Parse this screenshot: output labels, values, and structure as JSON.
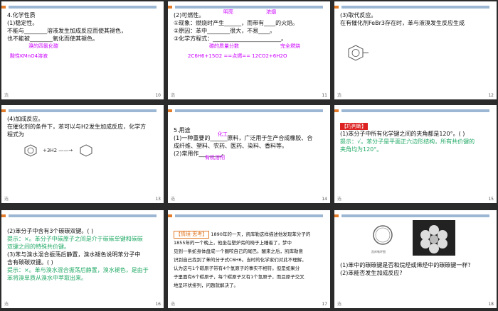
{
  "slides": [
    {
      "num": "10",
      "corner": "选",
      "lines": [
        "4.化学性质",
        "(1)稳定性。",
        "不能与________溶液发生加成反应而使其褪色，",
        "也不能被________氧化而使其褪色。"
      ],
      "answers": [
        "溴的四氯化碳",
        "酸性KMnO4溶液"
      ]
    },
    {
      "num": "11",
      "corner": "选",
      "lines": [
        "(2)可燃性。",
        "①现象：燃烧时产生______，而带有____的火焰。",
        "②原因：苯中________很大，不易____。",
        "③化学方程式：________________________。"
      ],
      "answers": [
        "明亮",
        "浓烟",
        "碳的质量分数",
        "完全燃烧",
        "2C6H6+15O2 ==点燃== 12CO2+6H2O"
      ]
    },
    {
      "num": "12",
      "corner": "选",
      "lines": [
        "(3)取代反应。",
        "在有催化剂FeBr3存在时，苯与液溴发生反应生成"
      ]
    },
    {
      "num": "13",
      "corner": "选",
      "lines": [
        "(4)加成反应。",
        "在催化剂的条件下，苯可以与H2发生加成反应，化学方",
        "程式为"
      ],
      "equation": "+3H2 ——→"
    },
    {
      "num": "14",
      "corner": "选",
      "lines": [
        "5.用途",
        "(1)一种重要的______原料，广泛用于生产合成橡胶、合",
        "成纤维、塑料、农药、医药、染料、香料等。",
        "(2)常用作________。"
      ],
      "answers": [
        "化工",
        "有机溶剂"
      ]
    },
    {
      "num": "15",
      "corner": "选",
      "tag": "【巧判断】",
      "lines": [
        "(1)苯分子中所有化学键之间的夹角都是120°。(   )",
        "提示：√。苯分子是平面正六边形结构，所有共价键的",
        "夹角均为120°。"
      ]
    },
    {
      "num": "16",
      "corner": "选",
      "lines": [
        "(2)苯分子中含有3个碳碳双键。(     )",
        "提示：×。苯分子中碳原子之间是介于碳碳单键和碳碳",
        "双键之间的特殊共价键。",
        "(3)苯与溴水混合振荡后静置，溴水褪色说明苯分子中",
        "含有碳碳双键。(     )",
        "提示：×。苯与溴水混合振荡后静置，溴水褪色，是由于",
        "苯将溴单质从溴水中萃取出来。"
      ]
    },
    {
      "num": "17",
      "corner": "选",
      "tag": "【情境·思考】",
      "lines": [
        "1890年的一天，凯库勒这样描述他发现苯分子的",
        "1855年的一个晚上，他坐在壁炉旁的椅子上睡着了，梦中",
        "见到一条蛇身体盘成一个圈咬自己的尾巴。醒来之后，凯库勒意",
        "识到自己找到了苯的分子式C6H6。当时的化学家们对此不理解，",
        "认为这与1个碳原子带有4个氢原子的事实不相符。但是如果分",
        "子里面有6个碳原子，每个碳原子又有1个氢原子，而且原子交叉",
        "地呈环状排列，问题就解决了。"
      ]
    },
    {
      "num": "18",
      "corner": "选",
      "caption": "凯库勒环图",
      "lines": [
        "(1)苯中的碳碳键是否和烷烃或烯烃中的碳碳键一样?",
        "(2)苯能否发生加成反应?"
      ]
    }
  ]
}
